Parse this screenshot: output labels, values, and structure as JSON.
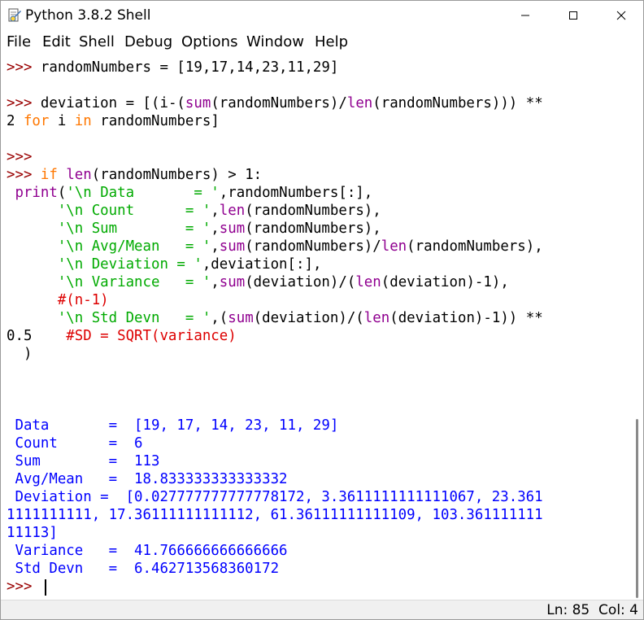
{
  "window": {
    "title": "Python 3.8.2 Shell"
  },
  "menu": [
    "File",
    "Edit",
    "Shell",
    "Debug",
    "Options",
    "Window",
    "Help"
  ],
  "editor": {
    "prompt": ">>> ",
    "prompt_continuation": ">>>",
    "lines": [
      "randomNumbers = [19,17,14,23,11,29]",
      "deviation = [(i-(",
      "sum",
      "(randomNumbers)/",
      "len",
      "(randomNumbers))) **",
      "2 ",
      "for",
      " i ",
      "in",
      " randomNumbers]",
      "if",
      " ",
      "len",
      "(randomNumbers) > 1:",
      " print",
      "(",
      "'\\n Data       = '",
      ",randomNumbers[:],",
      "      ",
      "'\\n Count      = '",
      ",",
      "len",
      "(randomNumbers),",
      "'\\n Sum        = '",
      ",",
      "sum",
      "(randomNumbers),",
      "'\\n Avg/Mean   = '",
      ",",
      "sum",
      "(randomNumbers)/",
      "len",
      "(randomNumbers),",
      "'\\n Deviation = '",
      ",deviation[:],",
      "'\\n Variance   = '",
      ",",
      "sum",
      "(deviation)/(",
      "len",
      "(deviation)-1),",
      "#(n-1)",
      "'\\n Std Devn   = '",
      ",(",
      "sum",
      "(deviation)/(",
      "len",
      "(deviation)-1)) **",
      "0.5    ",
      "#SD = SQRT(variance)",
      "  )"
    ],
    "output": [
      " Data       =  [19, 17, 14, 23, 11, 29]",
      " Count      =  6",
      " Sum        =  113",
      " Avg/Mean   =  18.833333333333332",
      " Deviation =  [0.027777777777778172, 3.3611111111111067, 23.361",
      "1111111111, 17.36111111111112, 61.36111111111109, 103.361111111",
      "11113]",
      " Variance   =  41.766666666666666",
      " Std Devn   =  6.462713568360172"
    ]
  },
  "status": {
    "line": "Ln: 85",
    "col": "Col: 4"
  },
  "colors": {
    "keyword": "#ff7700",
    "builtin": "#900090",
    "string": "#00aa00",
    "prompt": "#990000",
    "output": "#0000ff",
    "comment": "#dd0000"
  }
}
